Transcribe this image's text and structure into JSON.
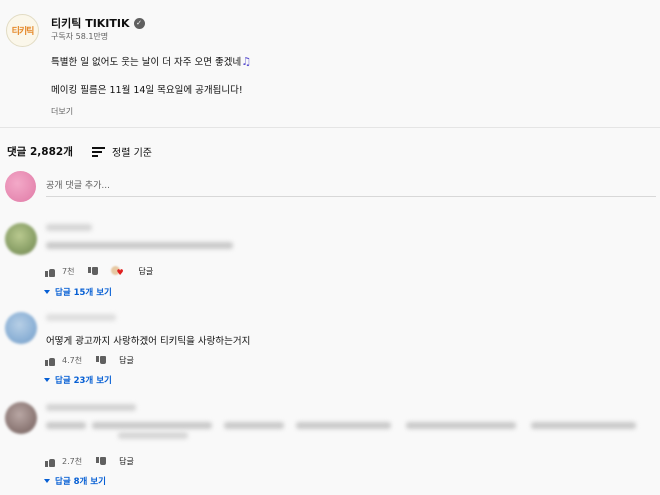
{
  "channel": {
    "avatar_text": "티키틱",
    "name": "티키틱 TIKITIK",
    "subscribers": "구독자 58.1만명",
    "description_line1": "특별한 일 없어도 웃는 날이 더 자주 오면 좋겠네",
    "description_line2": "메이킹 필름은 11월 14일 목요일에 공개됩니다!",
    "more_label": "더보기",
    "music_icon": "music-note-icon"
  },
  "comments_header": {
    "count_label": "댓글 2,882개",
    "sort_label": "정렬 기준"
  },
  "add_comment": {
    "placeholder": "공개 댓글 추가..."
  },
  "comments": [
    {
      "text": "",
      "likes": "7천",
      "reply_label": "답글",
      "view_replies": "답글 15개 보기",
      "creator_heart": true
    },
    {
      "text": "어떻게 광고까지 사랑하겠어 티키틱을 사랑하는거지",
      "likes": "4.7천",
      "reply_label": "답글",
      "view_replies": "답글 23개 보기"
    },
    {
      "text": "",
      "likes": "2.7천",
      "reply_label": "답글",
      "view_replies": "답글 8개 보기"
    }
  ],
  "colors": {
    "link": "#065fd4",
    "secondary_text": "#606060",
    "heart": "#e02020"
  }
}
